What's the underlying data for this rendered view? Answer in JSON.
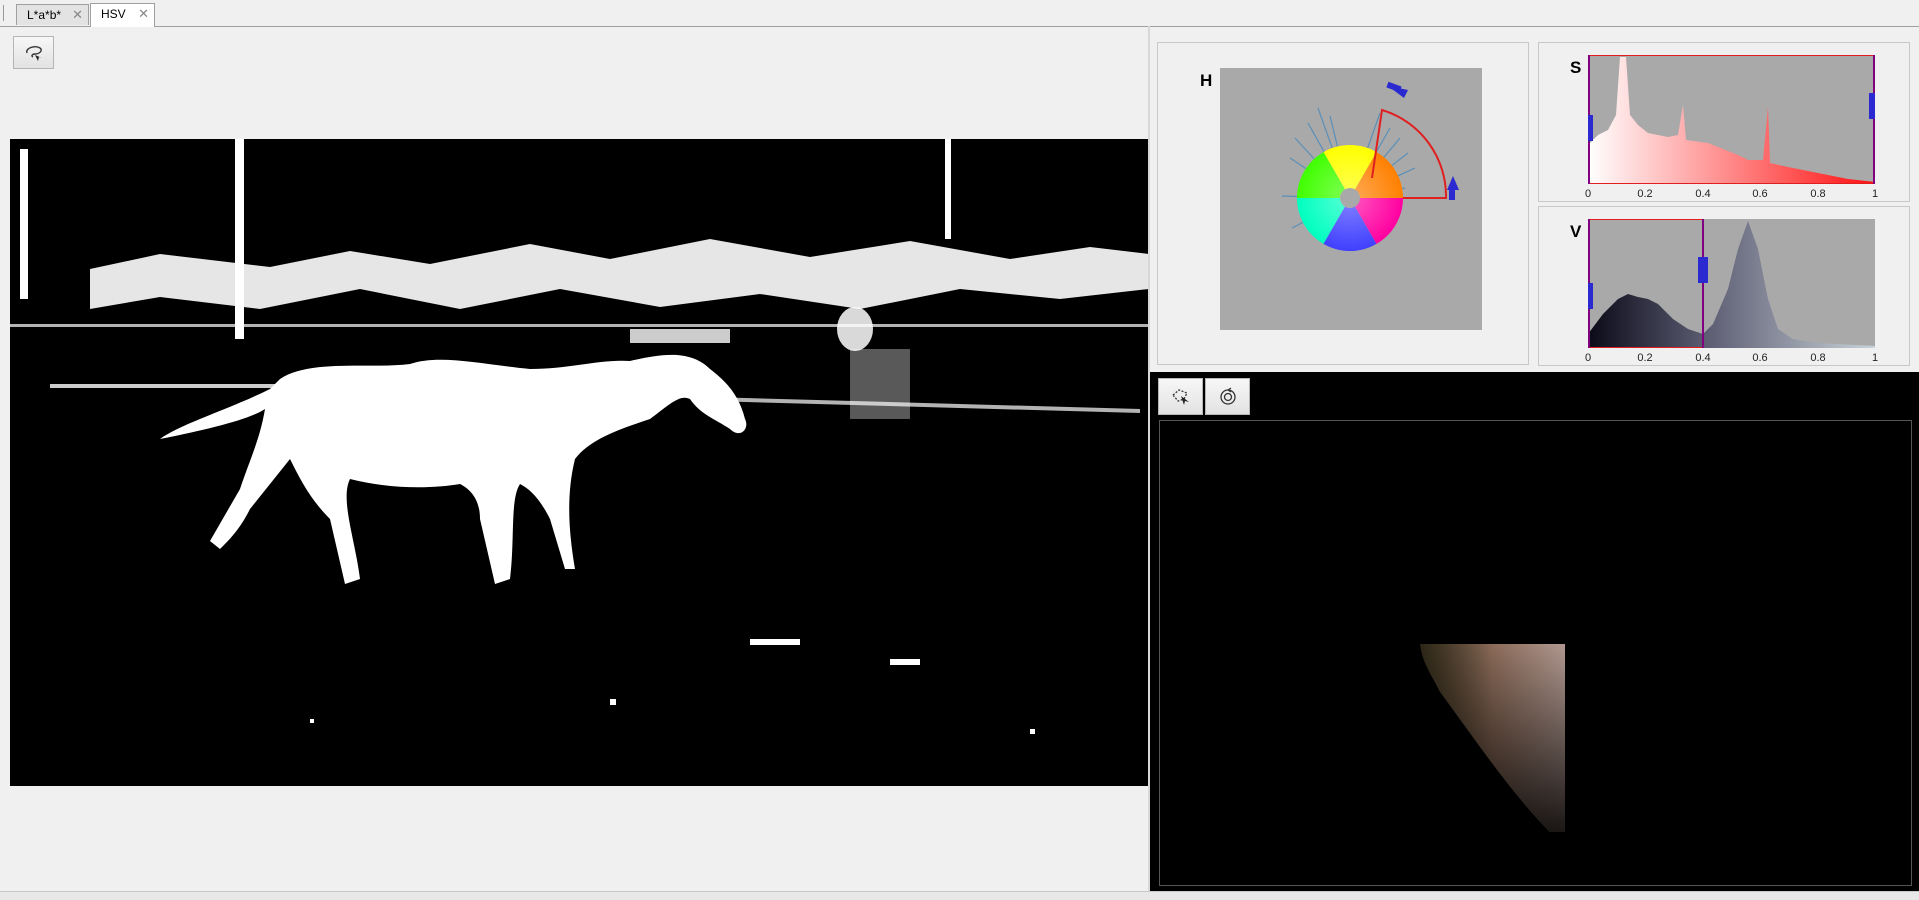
{
  "tabs": [
    {
      "label": "L*a*b*",
      "active": false
    },
    {
      "label": "HSV",
      "active": true
    }
  ],
  "icons": {
    "tab_close": "close-icon",
    "lasso": "freehand-select-icon",
    "rotate": "rotate-3d-icon",
    "point_cloud_region": "region-select-icon"
  },
  "hsv": {
    "h_label": "H",
    "s_label": "S",
    "v_label": "V",
    "s_ticks": [
      "0",
      "0.2",
      "0.4",
      "0.6",
      "0.8",
      "1"
    ],
    "v_ticks": [
      "0",
      "0.2",
      "0.4",
      "0.6",
      "0.8",
      "1"
    ],
    "s_range": [
      0.0,
      1.0
    ],
    "v_range": [
      0.0,
      0.4
    ]
  },
  "colors": {
    "handle": "#2a2ad0",
    "selection": "#e02020",
    "range_line": "#800080"
  }
}
